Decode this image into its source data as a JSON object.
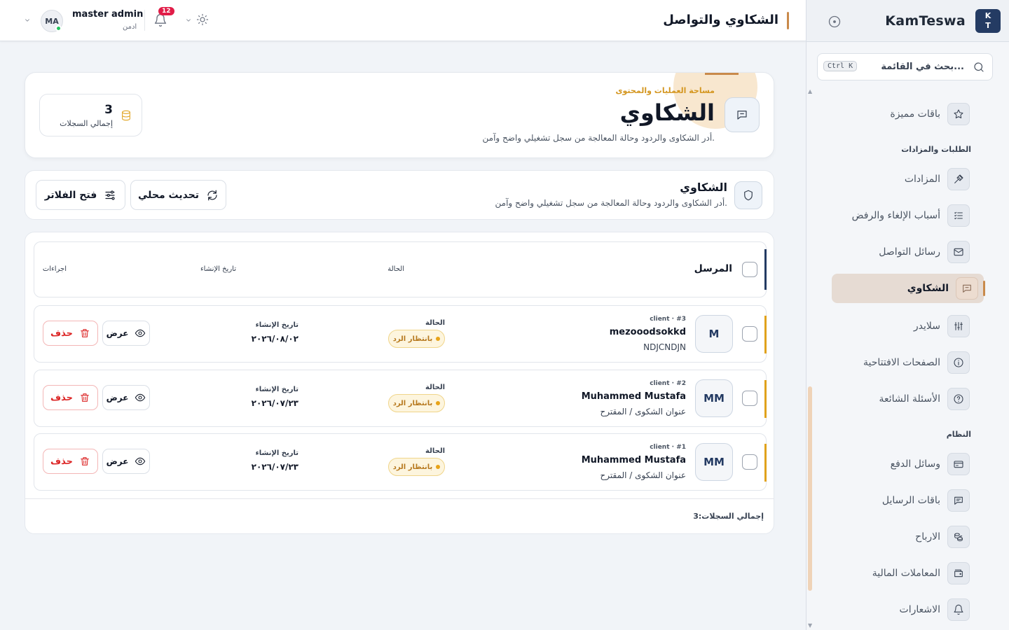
{
  "brand": {
    "name": "KamTeswa",
    "logo_line1": "K",
    "logo_line2": "T"
  },
  "sidebar": {
    "search_placeholder": "بحث في القائمة...",
    "search_shortcut": "Ctrl K",
    "items": [
      {
        "label": "باقات مميزة",
        "icon": "star-icon"
      },
      {
        "label": "المزادات",
        "icon": "gavel-icon"
      },
      {
        "label": "أسباب الإلغاء والرفض",
        "icon": "list-check-icon"
      },
      {
        "label": "رسائل التواصل",
        "icon": "mail-icon"
      },
      {
        "label": "الشكاوي",
        "icon": "chat-icon",
        "active": true
      },
      {
        "label": "سلايدر",
        "icon": "sliders-icon"
      },
      {
        "label": "الصفحات الافتتاحية",
        "icon": "info-icon"
      },
      {
        "label": "الأسئلة الشائعة",
        "icon": "help-icon"
      },
      {
        "label": "وسائل الدفع",
        "icon": "credit-card-icon"
      },
      {
        "label": "باقات الرسايل",
        "icon": "message-icon"
      },
      {
        "label": "الارباح",
        "icon": "coins-icon"
      },
      {
        "label": "المعاملات المالية",
        "icon": "wallet-icon"
      },
      {
        "label": "الاشعارات",
        "icon": "bell-icon"
      }
    ],
    "groups": {
      "orders": "الطلبات والمزادات",
      "system": "النظام"
    }
  },
  "topbar": {
    "title": "الشكاوي والتواصل",
    "notifications_count": "12",
    "user_name": "master admin",
    "user_role": "ادمن",
    "avatar_initials": "MA"
  },
  "hero": {
    "kicker": "مساحة العمليات والمحتوى",
    "title": "الشكاوي",
    "description": "أدر الشكاوى والردود وحالة المعالجة من سجل تشغيلي واضح وآمن.",
    "stat_value": "3",
    "stat_label": "إجمالي السجلات"
  },
  "toolbar": {
    "title": "الشكاوي",
    "description": "أدر الشكاوى والردود وحالة المعالجة من سجل تشغيلي واضح وآمن.",
    "refresh_label": "تحديث محلي",
    "filters_label": "فتح الفلاتر"
  },
  "table": {
    "headers": {
      "sender": "المرسل",
      "status": "الحالة",
      "created": "تاريخ الإنشاء",
      "actions": "اجراءات"
    },
    "rows": [
      {
        "initials": "M",
        "meta": "client · #3",
        "name": "mezooodsokkd",
        "subtitle": "NDJCNDJN",
        "status_label": "الحالة",
        "status": "بانتظار الرد",
        "date_label": "تاريخ الإنشاء",
        "date": "٢٠٢٦/٠٨/٠٢"
      },
      {
        "initials": "MM",
        "meta": "client · #2",
        "name": "Muhammed Mustafa",
        "subtitle": "عنوان الشكوى / المقترح",
        "status_label": "الحالة",
        "status": "بانتظار الرد",
        "date_label": "تاريخ الإنشاء",
        "date": "٢٠٢٦/٠٧/٢٣"
      },
      {
        "initials": "MM",
        "meta": "client · #1",
        "name": "Muhammed Mustafa",
        "subtitle": "عنوان الشكوى / المقترح",
        "status_label": "الحالة",
        "status": "بانتظار الرد",
        "date_label": "تاريخ الإنشاء",
        "date": "٢٠٢٦/٠٧/٢٣"
      }
    ],
    "view_label": "عرض",
    "delete_label": "حذف",
    "total_line": "إجمالي السجلات:3"
  },
  "colors": {
    "accent": "#c98a4b",
    "navy": "#243b63",
    "amber": "#e0a21c",
    "danger": "#dc2626"
  }
}
